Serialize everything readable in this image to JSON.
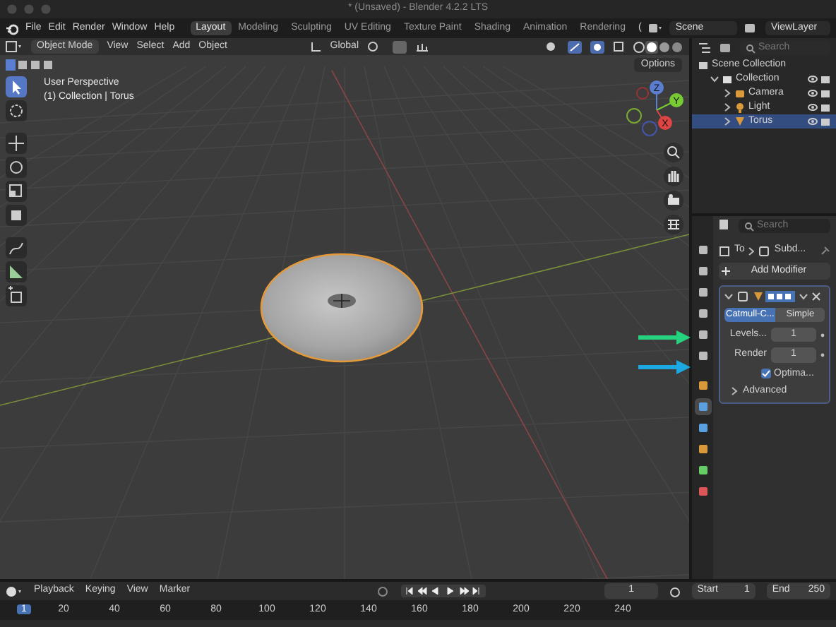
{
  "window": {
    "title": "* (Unsaved) - Blender 4.2.2 LTS"
  },
  "menu": [
    "File",
    "Edit",
    "Render",
    "Window",
    "Help"
  ],
  "workspaces": [
    {
      "label": "Layout",
      "selected": true
    },
    {
      "label": "Modeling",
      "selected": false
    },
    {
      "label": "Sculpting",
      "selected": false
    },
    {
      "label": "UV Editing",
      "selected": false
    },
    {
      "label": "Texture Paint",
      "selected": false
    },
    {
      "label": "Shading",
      "selected": false
    },
    {
      "label": "Animation",
      "selected": false
    },
    {
      "label": "Rendering",
      "selected": false
    }
  ],
  "workspace_overflow": "(",
  "scene": "Scene",
  "view_layer": "ViewLayer",
  "viewport": {
    "mode": "Object Mode",
    "menus": [
      "View",
      "Select",
      "Add",
      "Object"
    ],
    "orientation": "Global",
    "options": "Options",
    "info": [
      "User Perspective",
      "(1) Collection | Torus"
    ],
    "axes": [
      "Z",
      "Y",
      "X"
    ],
    "tools": [
      {
        "selected": true
      },
      {
        "selected": false
      },
      {
        "selected": false
      },
      {
        "selected": false
      },
      {
        "selected": false
      },
      {
        "selected": false
      },
      {
        "selected": false
      },
      {
        "selected": false
      },
      {
        "selected": false
      }
    ]
  },
  "outliner": {
    "search_placeholder": "Search",
    "items": [
      {
        "label": "Scene Collection",
        "children": [
          {
            "label": "Collection",
            "expanded": true,
            "selected": false,
            "children": [
              {
                "label": "Camera",
                "expanded": false,
                "selected": false
              },
              {
                "label": "Light",
                "expanded": false,
                "selected": false
              },
              {
                "label": "Torus",
                "expanded": false,
                "selected": true
              }
            ]
          }
        ]
      }
    ]
  },
  "properties": {
    "search_placeholder": "Search",
    "tabs": [
      {
        "selected": false
      },
      {
        "selected": false
      },
      {
        "selected": false
      },
      {
        "selected": false
      },
      {
        "selected": false
      },
      {
        "selected": false
      },
      {
        "selected": false
      },
      {
        "selected": true
      },
      {
        "selected": false
      },
      {
        "selected": false
      },
      {
        "selected": false
      },
      {
        "selected": false
      }
    ],
    "breadcrumb": [
      "To",
      "Subd..."
    ],
    "add_modifier": "Add Modifier",
    "modifier": {
      "expanded": true,
      "types": [
        {
          "label": "Catmull-C...",
          "selected": true
        },
        {
          "label": "Simple",
          "selected": false
        }
      ],
      "fields": [
        {
          "label": "Levels...",
          "value": "1"
        },
        {
          "label": "Render",
          "value": "1"
        }
      ],
      "optimal": {
        "label": "Optima...",
        "checked": true
      },
      "advanced": {
        "label": "Advanced",
        "expanded": false
      }
    }
  },
  "annotations": [
    {
      "color": "#25d27e"
    },
    {
      "color": "#1ca9e2"
    }
  ],
  "timeline": {
    "menus": [
      "Playback",
      "Keying",
      "View",
      "Marker"
    ],
    "current_frame": "1",
    "start_label": "Start",
    "start": "1",
    "end_label": "End",
    "end": "250",
    "ruler": [
      {
        "label": "1",
        "selected": true
      },
      {
        "label": "20",
        "selected": false
      },
      {
        "label": "40",
        "selected": false
      },
      {
        "label": "60",
        "selected": false
      },
      {
        "label": "80",
        "selected": false
      },
      {
        "label": "100",
        "selected": false
      },
      {
        "label": "120",
        "selected": false
      },
      {
        "label": "140",
        "selected": false
      },
      {
        "label": "160",
        "selected": false
      },
      {
        "label": "180",
        "selected": false
      },
      {
        "label": "200",
        "selected": false
      },
      {
        "label": "220",
        "selected": false
      },
      {
        "label": "240",
        "selected": false
      }
    ]
  }
}
